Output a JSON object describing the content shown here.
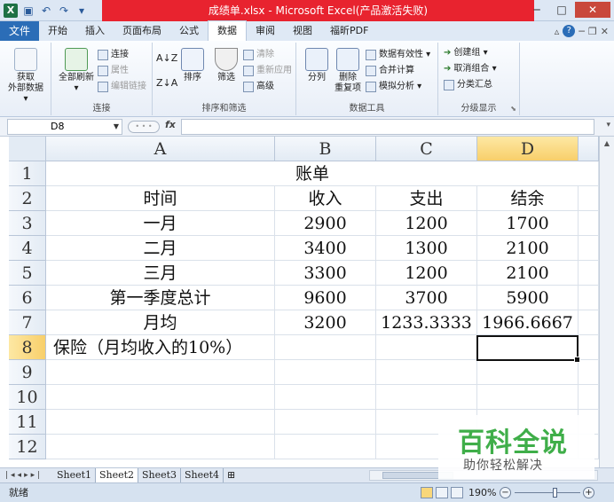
{
  "window": {
    "title": "成绩单.xlsx - Microsoft Excel(产品激活失败)",
    "controls": {
      "minimize": "─",
      "maximize": "□",
      "close": "✕"
    },
    "qat_icons": [
      "excel-logo-icon",
      "save-icon",
      "undo-icon",
      "redo-icon",
      "customize-icon"
    ]
  },
  "tabs": {
    "file": "文件",
    "items": [
      "开始",
      "插入",
      "页面布局",
      "公式",
      "数据",
      "审阅",
      "视图",
      "福昕PDF"
    ],
    "active": "数据"
  },
  "ribbon": {
    "get_external": {
      "label": "获取\n外部数据",
      "label1": "获取",
      "label2": "外部数据 ▾"
    },
    "connections": {
      "refresh_all": "全部刷新",
      "connections": "连接",
      "properties": "属性",
      "edit_links": "编辑链接",
      "group": "连接"
    },
    "sort_filter": {
      "sort": "排序",
      "filter": "筛选",
      "clear": "清除",
      "reapply": "重新应用",
      "advanced": "高级",
      "group": "排序和筛选"
    },
    "data_tools": {
      "text_to_columns": "分列",
      "remove_duplicates1": "删除",
      "remove_duplicates2": "重复项",
      "data_validation": "数据有效性 ▾",
      "consolidate": "合并计算",
      "what_if": "模拟分析 ▾",
      "group": "数据工具"
    },
    "outline": {
      "group_btn": "创建组 ▾",
      "ungroup": "取消组合 ▾",
      "subtotal": "分类汇总",
      "group": "分级显示"
    }
  },
  "formula_bar": {
    "name_box": "D8",
    "fx": "fx",
    "formula": ""
  },
  "sheet": {
    "columns": [
      "A",
      "B",
      "C",
      "D"
    ],
    "rows": [
      "1",
      "2",
      "3",
      "4",
      "5",
      "6",
      "7",
      "8",
      "9",
      "10",
      "11",
      "12"
    ],
    "selected_cell": "D8",
    "title": "账单",
    "header": [
      "时间",
      "收入",
      "支出",
      "结余"
    ],
    "data": [
      [
        "一月",
        "2900",
        "1200",
        "1700"
      ],
      [
        "二月",
        "3400",
        "1300",
        "2100"
      ],
      [
        "三月",
        "3300",
        "1200",
        "2100"
      ],
      [
        "第一季度总计",
        "9600",
        "3700",
        "5900"
      ],
      [
        "月均",
        "3200",
        "1233.3333",
        "1966.6667"
      ]
    ],
    "insurance_label": "保险（月均收入的10%）"
  },
  "sheet_tabs": [
    "Sheet1",
    "Sheet2",
    "Sheet3",
    "Sheet4"
  ],
  "active_sheet": "Sheet2",
  "status": {
    "mode": "就绪",
    "zoom": "190%"
  },
  "watermark": {
    "brand": "百科全说",
    "slogan": "助你轻松解决"
  },
  "colors": {
    "title_red": "#e8232f",
    "file_tab": "#2b6db7",
    "selection": "#f8cf6a",
    "watermark_green": "#3fae49"
  }
}
